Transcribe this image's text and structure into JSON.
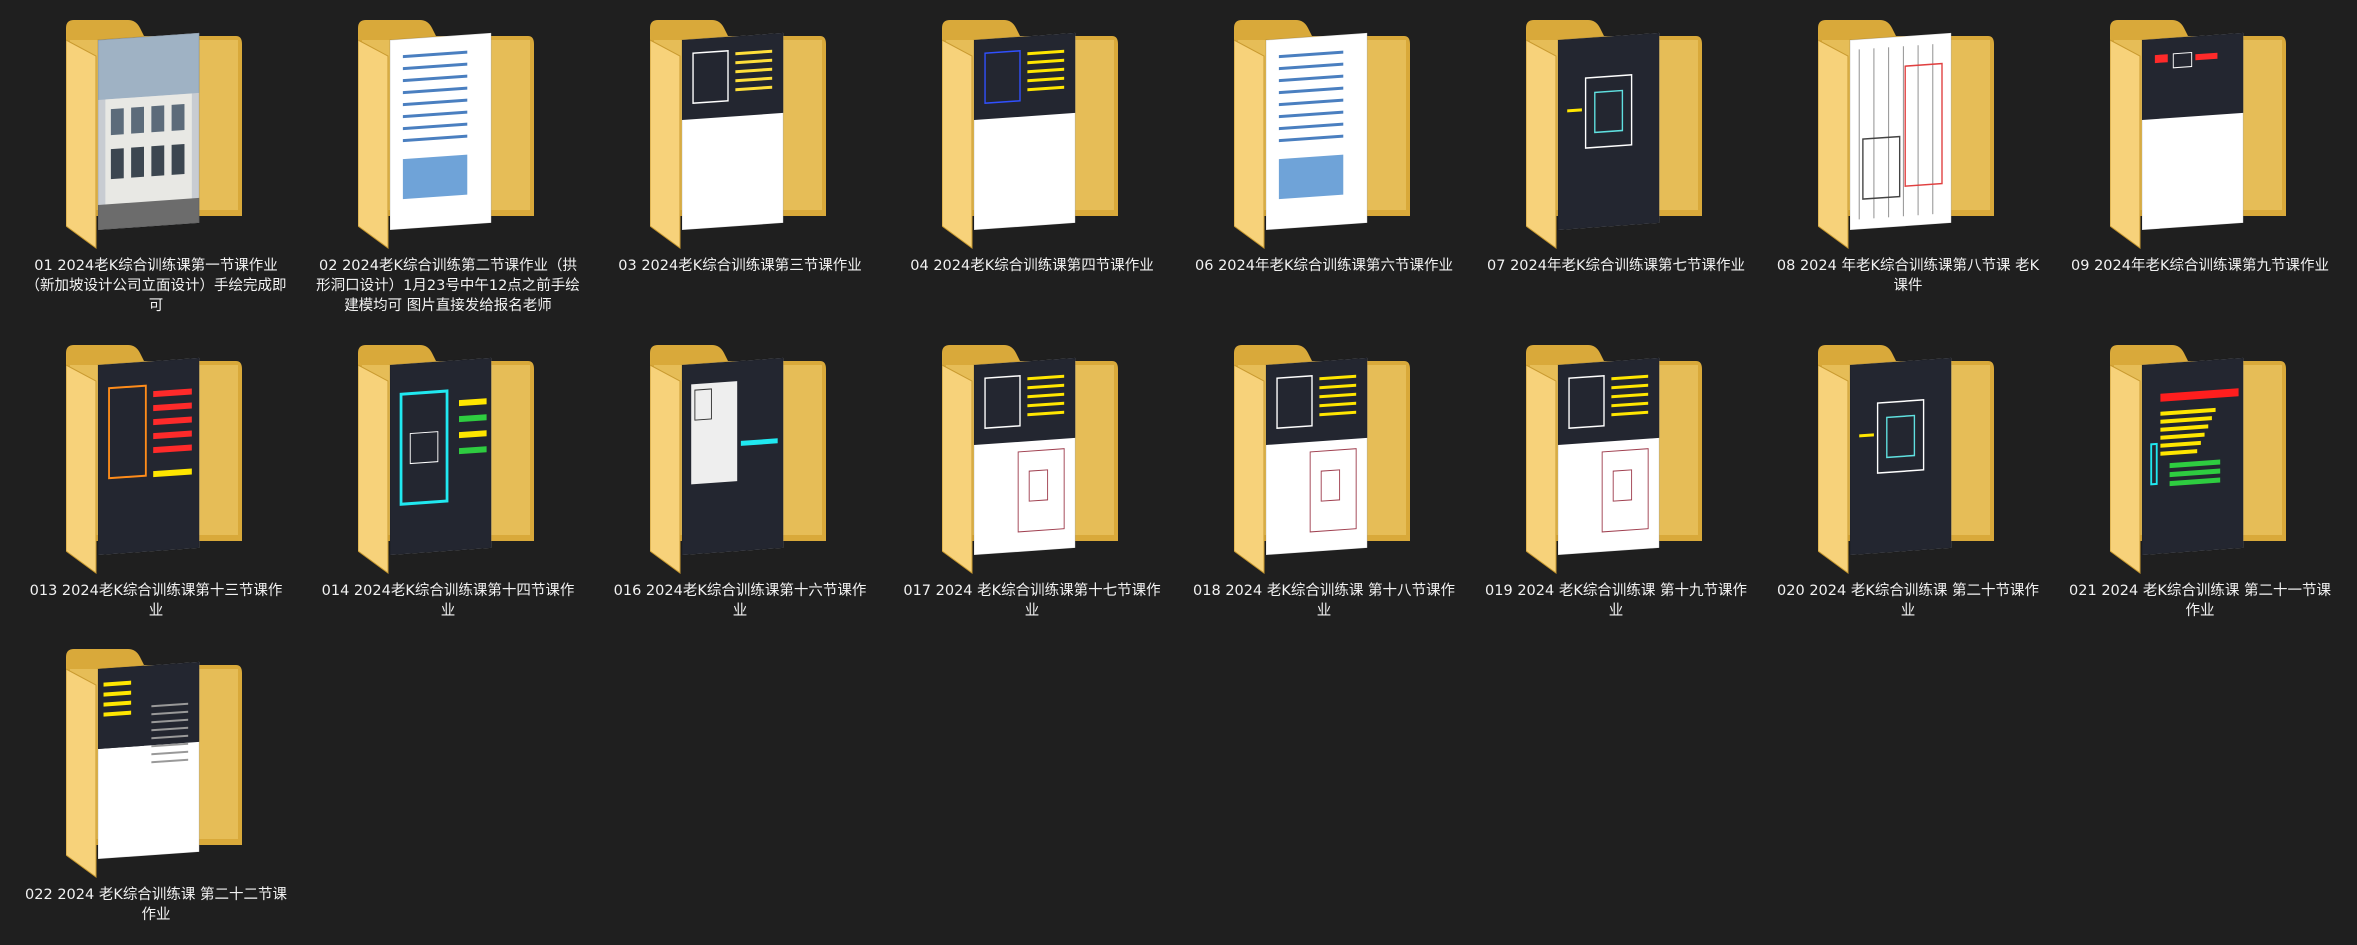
{
  "items": [
    {
      "label": "01 2024老K综合训练课第一节课作业（新加坡设计公司立面设计）手绘完成即可",
      "preview": "photo"
    },
    {
      "label": "02 2024老K综合训练第二节课作业（拱形洞口设计）1月23号中午12点之前手绘建模均可 图片直接发给报名老师",
      "preview": "docs"
    },
    {
      "label": "03 2024老K综合训练课第三节课作业",
      "preview": "cad-plan"
    },
    {
      "label": "04 2024老K综合训练课第四节课作业",
      "preview": "cad-blue"
    },
    {
      "label": "06 2024年老K综合训练课第六节课作业",
      "preview": "docs"
    },
    {
      "label": "07 2024年老K综合训练课第七节课作业",
      "preview": "cad-dark"
    },
    {
      "label": "08 2024 年老K综合训练课第八节课 老K课件",
      "preview": "elevation"
    },
    {
      "label": "09 2024年老K综合训练课第九节课作业",
      "preview": "cad-red"
    },
    {
      "label": "013 2024老K综合训练课第十三节课作业",
      "preview": "cad-yellow"
    },
    {
      "label": "014 2024老K综合训练课第十四节课作业",
      "preview": "cad-cyan"
    },
    {
      "label": "016 2024老K综合训练课第十六节课作业",
      "preview": "cad-white"
    },
    {
      "label": "017 2024 老K综合训练课第十七节课作业",
      "preview": "cad-mixed"
    },
    {
      "label": "018 2024 老K综合训练课 第十八节课作业",
      "preview": "cad-mixed"
    },
    {
      "label": "019 2024 老K综合训练课 第十九节课作业",
      "preview": "cad-mixed"
    },
    {
      "label": "020 2024 老K综合训练课 第二十节课作业",
      "preview": "cad-dark"
    },
    {
      "label": "021 2024 老K综合训练课 第二十一节课作业",
      "preview": "cad-bars"
    },
    {
      "label": "022 2024 老K综合训练课 第二十二节课作业",
      "preview": "cad-doc"
    }
  ]
}
